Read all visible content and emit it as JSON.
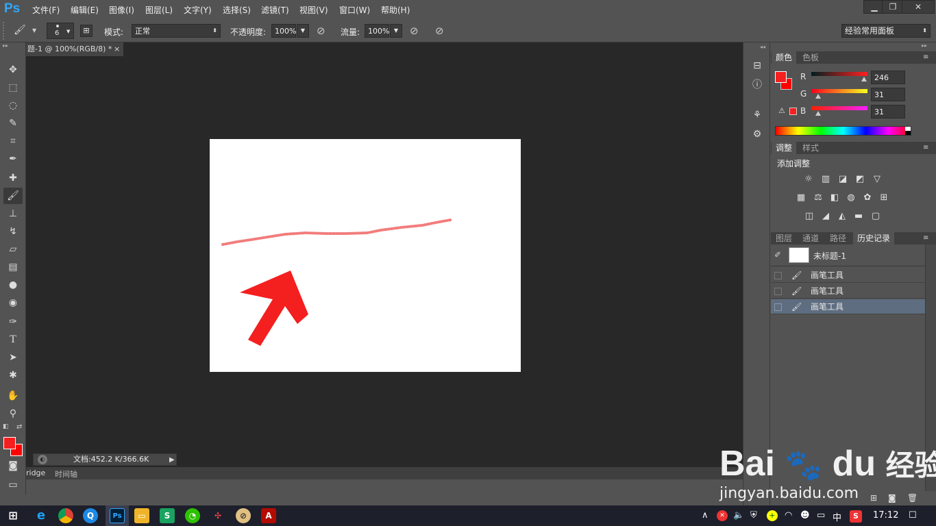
{
  "app": {
    "logo": "Ps",
    "title_icons": [
      "minimize-icon",
      "restore-icon",
      "close-icon"
    ],
    "minimize": "▁",
    "restore": "❐",
    "close": "✕"
  },
  "menu": [
    "文件(F)",
    "编辑(E)",
    "图像(I)",
    "图层(L)",
    "文字(Y)",
    "选择(S)",
    "滤镜(T)",
    "视图(V)",
    "窗口(W)",
    "帮助(H)"
  ],
  "options": {
    "brush_size": "6",
    "mode_label": "模式:",
    "mode_value": "正常",
    "opacity_label": "不透明度:",
    "opacity_value": "100%",
    "flow_label": "流量:",
    "flow_value": "100%",
    "workspace": "经验常用面板"
  },
  "document": {
    "tab_title": "题-1 @ 100%(RGB/8) *",
    "close": "×",
    "status": "文档:452.2 K/366.6K"
  },
  "bottom_tabs": [
    "ridge",
    "时间轴"
  ],
  "color_panel": {
    "tabs": [
      "颜色",
      "色板"
    ],
    "r_label": "R",
    "g_label": "G",
    "b_label": "B",
    "r": "246",
    "g": "31",
    "b": "31",
    "fg_color": "#f61f1f",
    "bg_color": "#ff0000"
  },
  "adjust_panel": {
    "tabs": [
      "调整",
      "样式"
    ],
    "title": "添加调整"
  },
  "history_panel": {
    "tabs": [
      "图层",
      "通道",
      "路径",
      "历史记录"
    ],
    "snapshot": "未标题-1",
    "items": [
      "画笔工具",
      "画笔工具",
      "画笔工具"
    ]
  },
  "taskbar": {
    "time": "17:12",
    "ime": "中"
  },
  "watermark": {
    "brand": "Bai",
    "brand2": "du",
    "suffix": "经验",
    "url": "jingyan.baidu.com"
  }
}
